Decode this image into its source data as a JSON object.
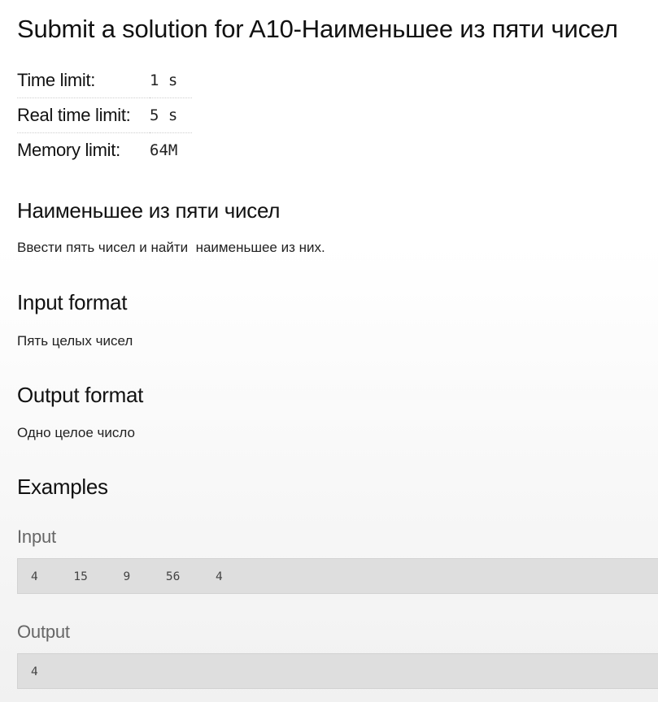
{
  "page": {
    "title": "Submit a solution for A10-Наименьшее из пяти чисел"
  },
  "limits": [
    {
      "label": "Time limit:",
      "value": "1 s"
    },
    {
      "label": "Real time limit:",
      "value": "5 s"
    },
    {
      "label": "Memory limit:",
      "value": "64M"
    }
  ],
  "problem": {
    "heading": "Наименьшее из пяти чисел",
    "statement": "Ввести пять чисел и найти  наименьшее из них."
  },
  "input_format": {
    "heading": "Input format",
    "text": "Пять целых чисел"
  },
  "output_format": {
    "heading": "Output format",
    "text": "Одно целое число"
  },
  "examples": {
    "heading": "Examples",
    "input_label": "Input",
    "input_value": "4     15     9     56     4",
    "output_label": "Output",
    "output_value": "4"
  }
}
